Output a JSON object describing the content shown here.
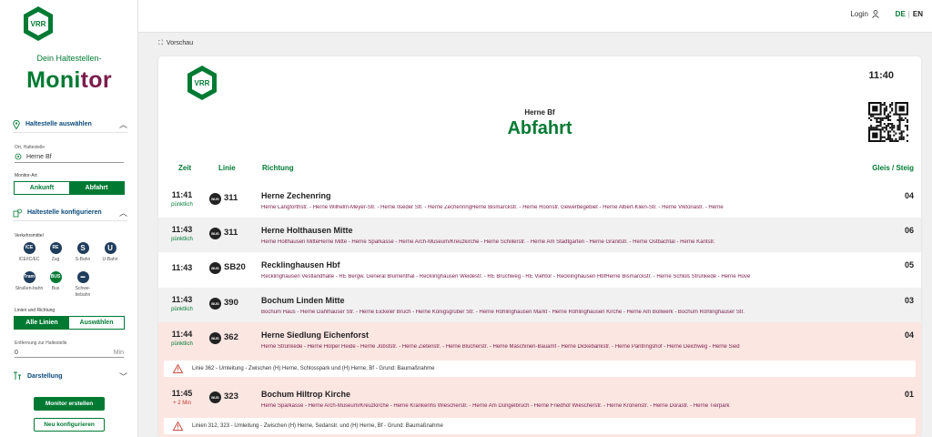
{
  "header": {
    "login": "Login",
    "lang_de": "DE",
    "lang_sep": "|",
    "lang_en": "EN"
  },
  "sidebar": {
    "tagline": "Dein Haltestellen-",
    "monitor_a": "Mo",
    "monitor_b": "ni",
    "monitor_c": "tor",
    "select_stop": "Haltestelle auswählen",
    "stop_label": "Ort, Haltestelle",
    "stop_value": "Herne Bf",
    "monitor_type_label": "Monitor-Art",
    "type_arrival": "Ankunft",
    "type_departure": "Abfahrt",
    "configure": "Haltestelle konfigurieren",
    "transport_label": "Verkehrsmittel",
    "transport": [
      {
        "icon": "ICE",
        "name": "ICE/IC/EC",
        "color": "#1f3d5c"
      },
      {
        "icon": "RE",
        "name": "Zug",
        "color": "#1f3d5c"
      },
      {
        "icon": "S",
        "name": "S-Bahn",
        "color": "#1f3d5c"
      },
      {
        "icon": "U",
        "name": "U-Bahn",
        "color": "#1f3d5c"
      },
      {
        "icon": "Tram",
        "name": "Straßen-bahn",
        "color": "#1f3d5c"
      },
      {
        "icon": "BUS",
        "name": "Bus",
        "color": "#007a33"
      },
      {
        "icon": "▬",
        "name": "Schwe-bebahn",
        "color": "#1f3d5c"
      }
    ],
    "lines_label": "Linien und Richtung",
    "all_lines": "Alle Linien",
    "choose": "Auswählen",
    "distance_label": "Entfernung zur Haltestelle",
    "distance_value": "0",
    "distance_unit": "Min",
    "display": "Darstellung",
    "create": "Monitor erstellen",
    "reconfigure": "Neu konfigurieren"
  },
  "preview": {
    "label": "Vorschau"
  },
  "board": {
    "time": "11:40",
    "station": "Herne Bf",
    "title": "Abfahrt",
    "col_time": "Zeit",
    "col_line": "Linie",
    "col_dir": "Richtung",
    "col_platform": "Gleis / Steig",
    "rows": [
      {
        "time": "11:41",
        "status": "pünktlich",
        "line": "311",
        "dir": "Herne Zechenring",
        "stops": "Herne Langforthstr. - Herne Wilhelm-Meyer-Str. - Herne Ilseder Str. - Herne ZechenringHerne Bismarckstr. - Herne Roonstr. Gewerbegebiet - Herne Albert-Klein-Str. - Herne Viktoriastr. - Herne",
        "platform": "04"
      },
      {
        "time": "11:43",
        "status": "pünktlich",
        "line": "311",
        "dir": "Herne Holthausen Mitte",
        "stops": "Herne Holthausen MitteHerne Mitte - Herne Sparkasse - Herne Arch-Museum/Kreuzkirche - Herne Schillerstr. - Herne Am Stadtgarten - Herne Granitstr. - Herne Ostbachtal - Herne Kantstr.",
        "platform": "06"
      },
      {
        "time": "11:43",
        "status": "",
        "line": "SB20",
        "dir": "Recklinghausen Hbf",
        "stops": "Recklinghausen Vestlandhalle - RE Bergw. General Blumenthal - Recklinghausen Weidestr. - RE Bruchweg - RE Viehtor - Recklinghausen HbfHerne Bismarckstr. - Herne Schloß Strünkede - Herne Hove",
        "platform": "05"
      },
      {
        "time": "11:43",
        "status": "pünktlich",
        "line": "390",
        "dir": "Bochum Linden Mitte",
        "stops": "Bochum Haus - Herne Dahlhauser Str. - Herne Eickeler Bruch - Herne Königsgruber Str. - Herne Röhlinghausen Markt - Herne Röhlinghausen Kirche - Herne Am Bollwerk - Bochum Röhlinghauser Str.",
        "platform": "03"
      },
      {
        "time": "11:44",
        "status": "pünktlich",
        "line": "362",
        "dir": "Herne Siedlung Eichenforst",
        "stops": "Herne Strünkede - Herne Holper Heide - Herne Jobststr. - Herne Zietenstr. - Herne Blücherstr. - Herne Maschinen-Bauamt - Herne Dickebankstr. - Herne Pantringshof - Herne Deichweg - Herne Sied",
        "platform": "04"
      },
      {
        "time": "11:45",
        "status": "+ 2 Min",
        "line": "323",
        "dir": "Bochum Hiltrop Kirche",
        "stops": "Herne Sparkasse - Herne Arch-Museum/Kreuzkirche - Herne Krankenhs Wiescherstr. - Herne Am Düngelbruch - Herne Friedhof Wiescherstr. - Herne Kronenstr. - Herne Dorastr. - Herne Tierpark",
        "platform": "01"
      }
    ],
    "notice1": "Linie 362 - Umleitung - Zwischen (H) Herne, Schlosspark und (H) Herne, Bf - Grund: Baumaßnahme",
    "notice2": "Linien 312, 323 - Umleitung - Zwischen (H) Herne, Sedanstr. und (H) Herne, Bf - Grund: Baumaßnahme",
    "logo_text": "VRR"
  },
  "colors": {
    "green": "#007a33",
    "purple": "#7b1d4a",
    "warn": "#fbe6e2",
    "late": "#c0392b"
  }
}
